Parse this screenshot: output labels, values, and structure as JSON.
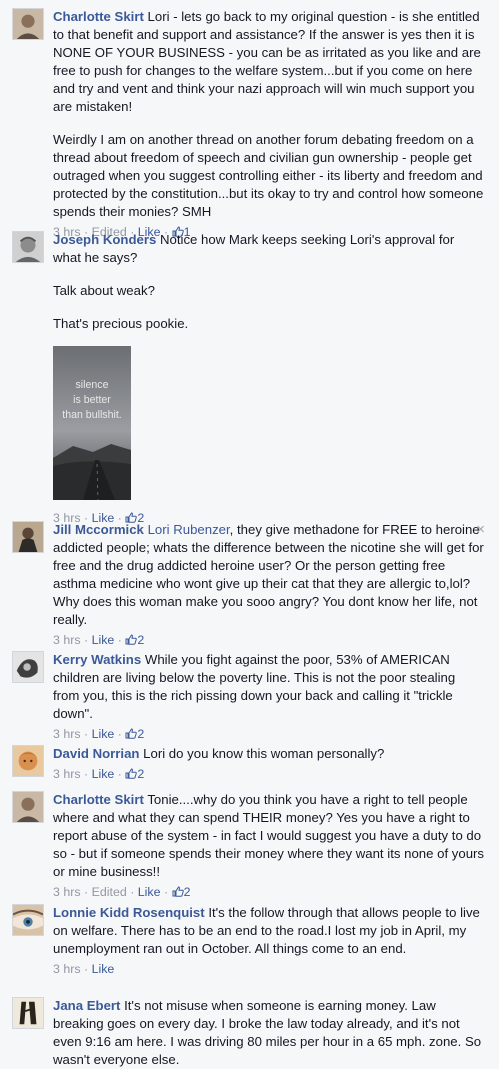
{
  "ui": {
    "dot": "·",
    "like": "Like",
    "edited": "Edited",
    "close_glyph": "×"
  },
  "comments": [
    {
      "author": "Charlotte Skirt",
      "paragraphs": [
        "Lori - lets go back to my original question - is she entitled to that benefit and support and assistance? If the answer is yes then it is NONE OF YOUR BUSINESS - you can be as irritated as you like and are free to push for changes to the welfare system...but if you come on here and try and vent and think your nazi approach will win much support you are mistaken!",
        "Weirdly I am on another thread on another forum debating freedom on a thread about freedom of speech and civilian gun ownership - people get outraged when you suggest controlling either - its liberty and freedom and protected by the constitution...but its okay to try and control how someone spends their monies? SMH"
      ],
      "time": "3 hrs",
      "likes": "1"
    },
    {
      "author": "Joseph Konders",
      "paragraphs": [
        "Notice how Mark keeps seeking Lori's approval for what he says?",
        "Talk about weak?",
        "That's precious pookie."
      ],
      "photo_text": [
        "silence",
        "is better",
        "than bullshit."
      ],
      "time": "3 hrs",
      "likes": "2"
    },
    {
      "author": "Jill Mccormick",
      "mention": "Lori Rubenzer",
      "text": ", they give methadone for FREE to heroine addicted people; whats the difference between the nicotine she will get for free and the drug addicted heroine user? Or the person getting free asthma medicine who wont give up their cat that they are allergic to,lol? Why does this woman make you sooo angry? You dont know her life, not really.",
      "time": "3 hrs",
      "likes": "2"
    },
    {
      "author": "Kerry Watkins",
      "text": "While you fight against the poor, 53% of AMERICAN children are living below the poverty line. This is not the poor stealing from you, this is the rich pissing down your back and calling it \"trickle down\".",
      "time": "3 hrs",
      "likes": "2"
    },
    {
      "author": "David Norrian",
      "text": "Lori do you know this woman personally?",
      "time": "3 hrs",
      "likes": "2"
    },
    {
      "author": "Charlotte Skirt",
      "text": "Tonie....why do you think you have a right to tell people where and what they can spend THEIR money? Yes you have a right to report abuse of the system - in fact I would suggest you have a duty to do so - but if someone spends their money where they want its none of yours or mine business!!",
      "time": "3 hrs",
      "likes": "2"
    },
    {
      "author": "Lonnie Kidd Rosenquist",
      "text": "It's the follow through that allows people to live on welfare. There has to be an end to the road.I lost my job in April, my unemployment ran out in October. All things come to an end.",
      "time": "3 hrs"
    },
    {
      "author": "Jana Ebert",
      "text": "It's not misuse when someone is earning money. Law breaking goes on every day. I broke the law today already, and it's not even 9:16 am here. I was driving 80 miles per hour in a 65 mph. zone. So wasn't everyone else."
    }
  ]
}
